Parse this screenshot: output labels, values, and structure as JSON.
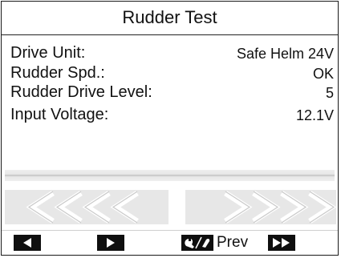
{
  "screen": {
    "title": "Rudder Test"
  },
  "fields": [
    {
      "label": "Drive Unit:",
      "value": "Safe Helm 24V"
    },
    {
      "label": "Rudder Spd.:",
      "value": "OK"
    },
    {
      "label": "Rudder Drive Level:",
      "value": "5"
    },
    {
      "label": "Input Voltage:",
      "value": "12.1V"
    }
  ],
  "rudder_indicator": {
    "port_chevrons": 4,
    "starboard_chevrons": 4
  },
  "softkeys": {
    "left_icon": "left-arrow-icon",
    "right_icon": "right-arrow-icon",
    "prev_icon": "tools-wrench-icon",
    "prev_label": "Prev",
    "forward_icon": "fast-forward-icon"
  },
  "colors": {
    "text": "#111111",
    "key_background": "#0f0f0f",
    "chevron_fill": "#e7e7e7",
    "chevron_stroke": "#bdbdbd"
  }
}
